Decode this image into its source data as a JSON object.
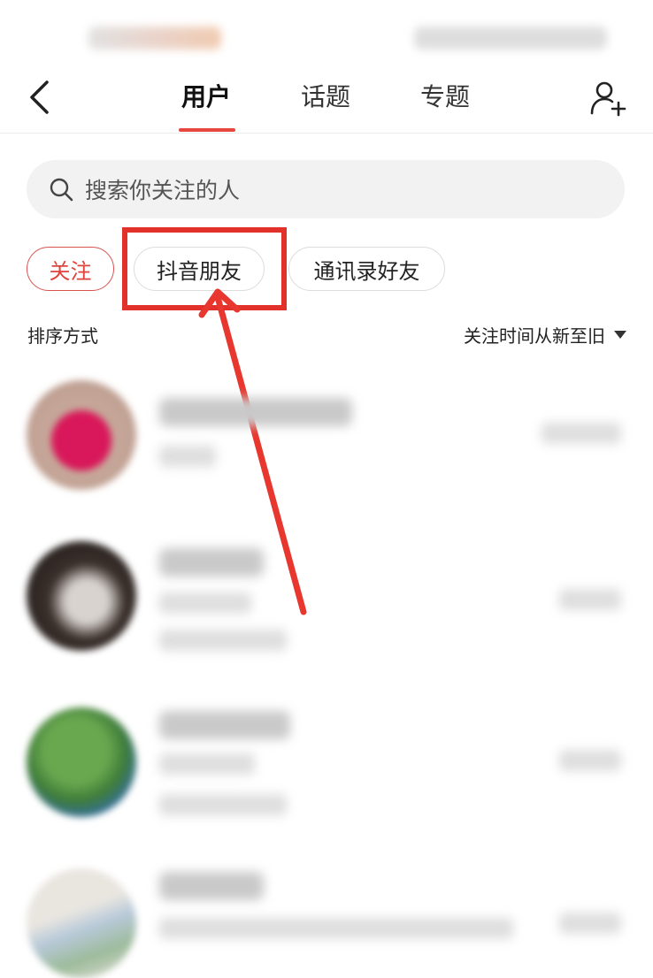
{
  "header": {
    "tabs": [
      {
        "label": "用户",
        "active": true
      },
      {
        "label": "话题",
        "active": false
      },
      {
        "label": "专题",
        "active": false
      }
    ]
  },
  "search": {
    "placeholder": "搜索你关注的人"
  },
  "filters": [
    {
      "label": "关注",
      "active": true
    },
    {
      "label": "抖音朋友",
      "active": false,
      "highlighted": true
    },
    {
      "label": "通讯录好友",
      "active": false
    }
  ],
  "sort": {
    "label": "排序方式",
    "value": "关注时间从新至旧"
  },
  "colors": {
    "accent": "#e8473f",
    "annotation": "#e2302b",
    "search_bg": "#f2f2f2"
  },
  "icons": [
    "back-icon",
    "add-user-icon",
    "search-icon",
    "caret-down-icon"
  ]
}
